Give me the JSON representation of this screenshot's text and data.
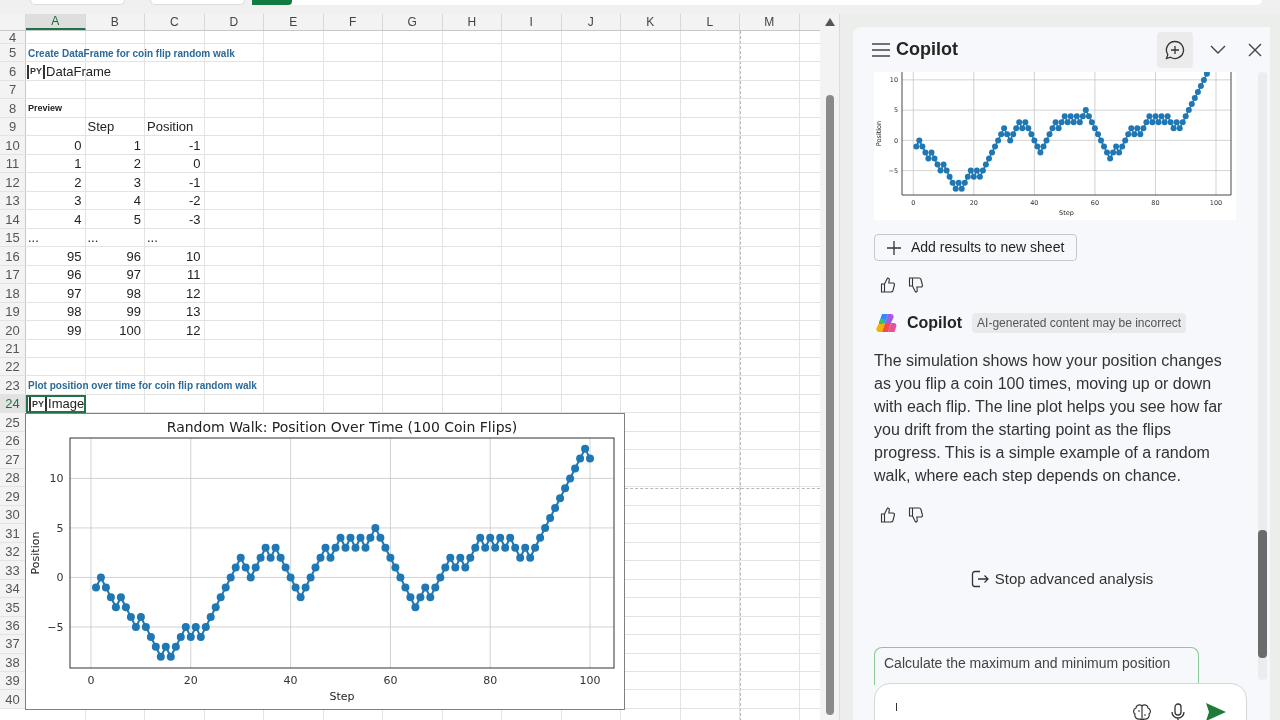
{
  "sheet": {
    "columns": [
      {
        "label": "A",
        "selected": true
      },
      {
        "label": "B",
        "selected": false
      },
      {
        "label": "C",
        "selected": false
      },
      {
        "label": "D",
        "selected": false
      },
      {
        "label": "E",
        "selected": false
      },
      {
        "label": "F",
        "selected": false
      },
      {
        "label": "G",
        "selected": false
      },
      {
        "label": "H",
        "selected": false
      },
      {
        "label": "I",
        "selected": false
      },
      {
        "label": "J",
        "selected": false
      },
      {
        "label": "K",
        "selected": false
      },
      {
        "label": "L",
        "selected": false
      },
      {
        "label": "M",
        "selected": false
      }
    ],
    "rows": [
      {
        "number": "4",
        "selected": false,
        "kind": "empty"
      },
      {
        "number": "5",
        "selected": false,
        "kind": "heading",
        "cells": [
          "Create DataFrame for coin flip random walk"
        ]
      },
      {
        "number": "6",
        "selected": false,
        "kind": "python",
        "badge": "PY",
        "cells": [
          "DataFrame"
        ]
      },
      {
        "number": "7",
        "selected": false,
        "kind": "empty"
      },
      {
        "number": "8",
        "selected": false,
        "kind": "label",
        "cells": [
          "Preview"
        ]
      },
      {
        "number": "9",
        "selected": false,
        "kind": "header",
        "cells": [
          "Step",
          "Position"
        ]
      },
      {
        "number": "10",
        "selected": false,
        "kind": "data",
        "cells": [
          "0",
          "1",
          "-1"
        ]
      },
      {
        "number": "11",
        "selected": false,
        "kind": "data",
        "cells": [
          "1",
          "2",
          "0"
        ]
      },
      {
        "number": "12",
        "selected": false,
        "kind": "data",
        "cells": [
          "2",
          "3",
          "-1"
        ]
      },
      {
        "number": "13",
        "selected": false,
        "kind": "data",
        "cells": [
          "3",
          "4",
          "-2"
        ]
      },
      {
        "number": "14",
        "selected": false,
        "kind": "data",
        "cells": [
          "4",
          "5",
          "-3"
        ]
      },
      {
        "number": "15",
        "selected": false,
        "kind": "ellipsis",
        "cells": [
          "...",
          "...",
          "..."
        ]
      },
      {
        "number": "16",
        "selected": false,
        "kind": "data",
        "cells": [
          "95",
          "96",
          "10"
        ]
      },
      {
        "number": "17",
        "selected": false,
        "kind": "data",
        "cells": [
          "96",
          "97",
          "11"
        ]
      },
      {
        "number": "18",
        "selected": false,
        "kind": "data",
        "cells": [
          "97",
          "98",
          "12"
        ]
      },
      {
        "number": "19",
        "selected": false,
        "kind": "data",
        "cells": [
          "98",
          "99",
          "13"
        ]
      },
      {
        "number": "20",
        "selected": false,
        "kind": "data",
        "cells": [
          "99",
          "100",
          "12"
        ]
      },
      {
        "number": "21",
        "selected": false,
        "kind": "empty"
      },
      {
        "number": "22",
        "selected": false,
        "kind": "empty"
      },
      {
        "number": "23",
        "selected": false,
        "kind": "heading",
        "cells": [
          "Plot position over time for coin flip random walk"
        ]
      },
      {
        "number": "24",
        "selected": true,
        "kind": "python",
        "badge": "PY",
        "cells": [
          "Image"
        ]
      },
      {
        "number": "25",
        "selected": false,
        "kind": "empty"
      },
      {
        "number": "26",
        "selected": false,
        "kind": "empty"
      },
      {
        "number": "27",
        "selected": false,
        "kind": "empty"
      },
      {
        "number": "28",
        "selected": false,
        "kind": "empty"
      },
      {
        "number": "29",
        "selected": false,
        "kind": "empty"
      },
      {
        "number": "30",
        "selected": false,
        "kind": "empty"
      },
      {
        "number": "31",
        "selected": false,
        "kind": "empty"
      },
      {
        "number": "32",
        "selected": false,
        "kind": "empty"
      },
      {
        "number": "33",
        "selected": false,
        "kind": "empty"
      },
      {
        "number": "34",
        "selected": false,
        "kind": "empty"
      },
      {
        "number": "35",
        "selected": false,
        "kind": "empty"
      },
      {
        "number": "36",
        "selected": false,
        "kind": "empty"
      },
      {
        "number": "37",
        "selected": false,
        "kind": "empty"
      },
      {
        "number": "38",
        "selected": false,
        "kind": "empty"
      },
      {
        "number": "39",
        "selected": false,
        "kind": "empty"
      },
      {
        "number": "40",
        "selected": false,
        "kind": "empty"
      }
    ]
  },
  "sheet_image": {
    "chart_data": {
      "type": "line",
      "title": "Random Walk: Position Over Time (100 Coin Flips)",
      "xlabel": "Step",
      "ylabel": "Position",
      "x": [
        1,
        2,
        3,
        4,
        5,
        6,
        7,
        8,
        9,
        10,
        11,
        12,
        13,
        14,
        15,
        16,
        17,
        18,
        19,
        20,
        21,
        22,
        23,
        24,
        25,
        26,
        27,
        28,
        29,
        30,
        31,
        32,
        33,
        34,
        35,
        36,
        37,
        38,
        39,
        40,
        41,
        42,
        43,
        44,
        45,
        46,
        47,
        48,
        49,
        50,
        51,
        52,
        53,
        54,
        55,
        56,
        57,
        58,
        59,
        60,
        61,
        62,
        63,
        64,
        65,
        66,
        67,
        68,
        69,
        70,
        71,
        72,
        73,
        74,
        75,
        76,
        77,
        78,
        79,
        80,
        81,
        82,
        83,
        84,
        85,
        86,
        87,
        88,
        89,
        90,
        91,
        92,
        93,
        94,
        95,
        96,
        97,
        98,
        99,
        100
      ],
      "series": [
        {
          "color": "#1f77b4",
          "marker": "circle",
          "values": [
            -1,
            0,
            -1,
            -2,
            -3,
            -2,
            -3,
            -4,
            -5,
            -4,
            -5,
            -6,
            -7,
            -8,
            -7,
            -8,
            -7,
            -6,
            -5,
            -6,
            -5,
            -6,
            -5,
            -4,
            -3,
            -2,
            -1,
            0,
            1,
            2,
            1,
            0,
            1,
            2,
            3,
            2,
            3,
            2,
            1,
            0,
            -1,
            -2,
            -1,
            0,
            1,
            2,
            3,
            2,
            3,
            4,
            3,
            4,
            3,
            4,
            3,
            4,
            5,
            4,
            3,
            2,
            1,
            0,
            -1,
            -2,
            -3,
            -2,
            -1,
            -2,
            -1,
            0,
            1,
            2,
            1,
            2,
            1,
            2,
            3,
            4,
            3,
            4,
            3,
            4,
            3,
            4,
            3,
            2,
            3,
            2,
            3,
            4,
            5,
            6,
            7,
            8,
            9,
            10,
            11,
            12,
            13,
            12
          ]
        }
      ],
      "xlim": [
        -4.2,
        104.8
      ],
      "ylim": [
        -9.14,
        14.08
      ],
      "xticks": [
        0,
        20,
        40,
        60,
        80,
        100
      ],
      "yticks": [
        {
          "value": -5,
          "label": "−5"
        },
        0,
        5,
        10
      ],
      "grid": true
    }
  },
  "copilot": {
    "title": "Copilot",
    "chart_data": {
      "type": "line",
      "xlabel": "Step",
      "ylabel": "Position",
      "x": [
        1,
        2,
        3,
        4,
        5,
        6,
        7,
        8,
        9,
        10,
        11,
        12,
        13,
        14,
        15,
        16,
        17,
        18,
        19,
        20,
        21,
        22,
        23,
        24,
        25,
        26,
        27,
        28,
        29,
        30,
        31,
        32,
        33,
        34,
        35,
        36,
        37,
        38,
        39,
        40,
        41,
        42,
        43,
        44,
        45,
        46,
        47,
        48,
        49,
        50,
        51,
        52,
        53,
        54,
        55,
        56,
        57,
        58,
        59,
        60,
        61,
        62,
        63,
        64,
        65,
        66,
        67,
        68,
        69,
        70,
        71,
        72,
        73,
        74,
        75,
        76,
        77,
        78,
        79,
        80,
        81,
        82,
        83,
        84,
        85,
        86,
        87,
        88,
        89,
        90,
        91,
        92,
        93,
        94,
        95,
        96,
        97
      ],
      "series": [
        {
          "color": "#1f77b4",
          "marker": "circle",
          "values": [
            -1,
            0,
            -1,
            -2,
            -3,
            -2,
            -3,
            -4,
            -5,
            -4,
            -5,
            -6,
            -7,
            -8,
            -7,
            -8,
            -7,
            -6,
            -5,
            -6,
            -5,
            -6,
            -5,
            -4,
            -3,
            -2,
            -1,
            0,
            1,
            2,
            1,
            0,
            1,
            2,
            3,
            2,
            3,
            2,
            1,
            0,
            -1,
            -2,
            -1,
            0,
            1,
            2,
            3,
            2,
            3,
            4,
            3,
            4,
            3,
            4,
            3,
            4,
            5,
            4,
            3,
            2,
            1,
            0,
            -1,
            -2,
            -3,
            -2,
            -1,
            -2,
            -1,
            0,
            1,
            2,
            1,
            2,
            1,
            2,
            3,
            4,
            3,
            4,
            3,
            4,
            3,
            4,
            3,
            2,
            3,
            2,
            3,
            4,
            5,
            6,
            7,
            8,
            9,
            10,
            11
          ]
        }
      ],
      "xlim": [
        -3.73,
        104.95
      ],
      "ylim": [
        -9.03,
        11.3
      ],
      "xticks": [
        0,
        20,
        40,
        60,
        80,
        100
      ],
      "yticks": [
        {
          "value": -5,
          "label": "−5"
        },
        0,
        5,
        10
      ],
      "grid": true
    },
    "add_button": "Add results to new sheet",
    "response": {
      "author": "Copilot",
      "disclaimer": "AI-generated content may be incorrect",
      "text": "The simulation shows how your position changes as you flip a coin 100 times, moving up or down with each flip. The line plot helps you see how far you drift from the starting point as the flips progress. This is a simple example of a random walk, where each step depends on chance."
    },
    "stop_button": "Stop advanced analysis",
    "suggestion": "Calculate the maximum and minimum position"
  }
}
